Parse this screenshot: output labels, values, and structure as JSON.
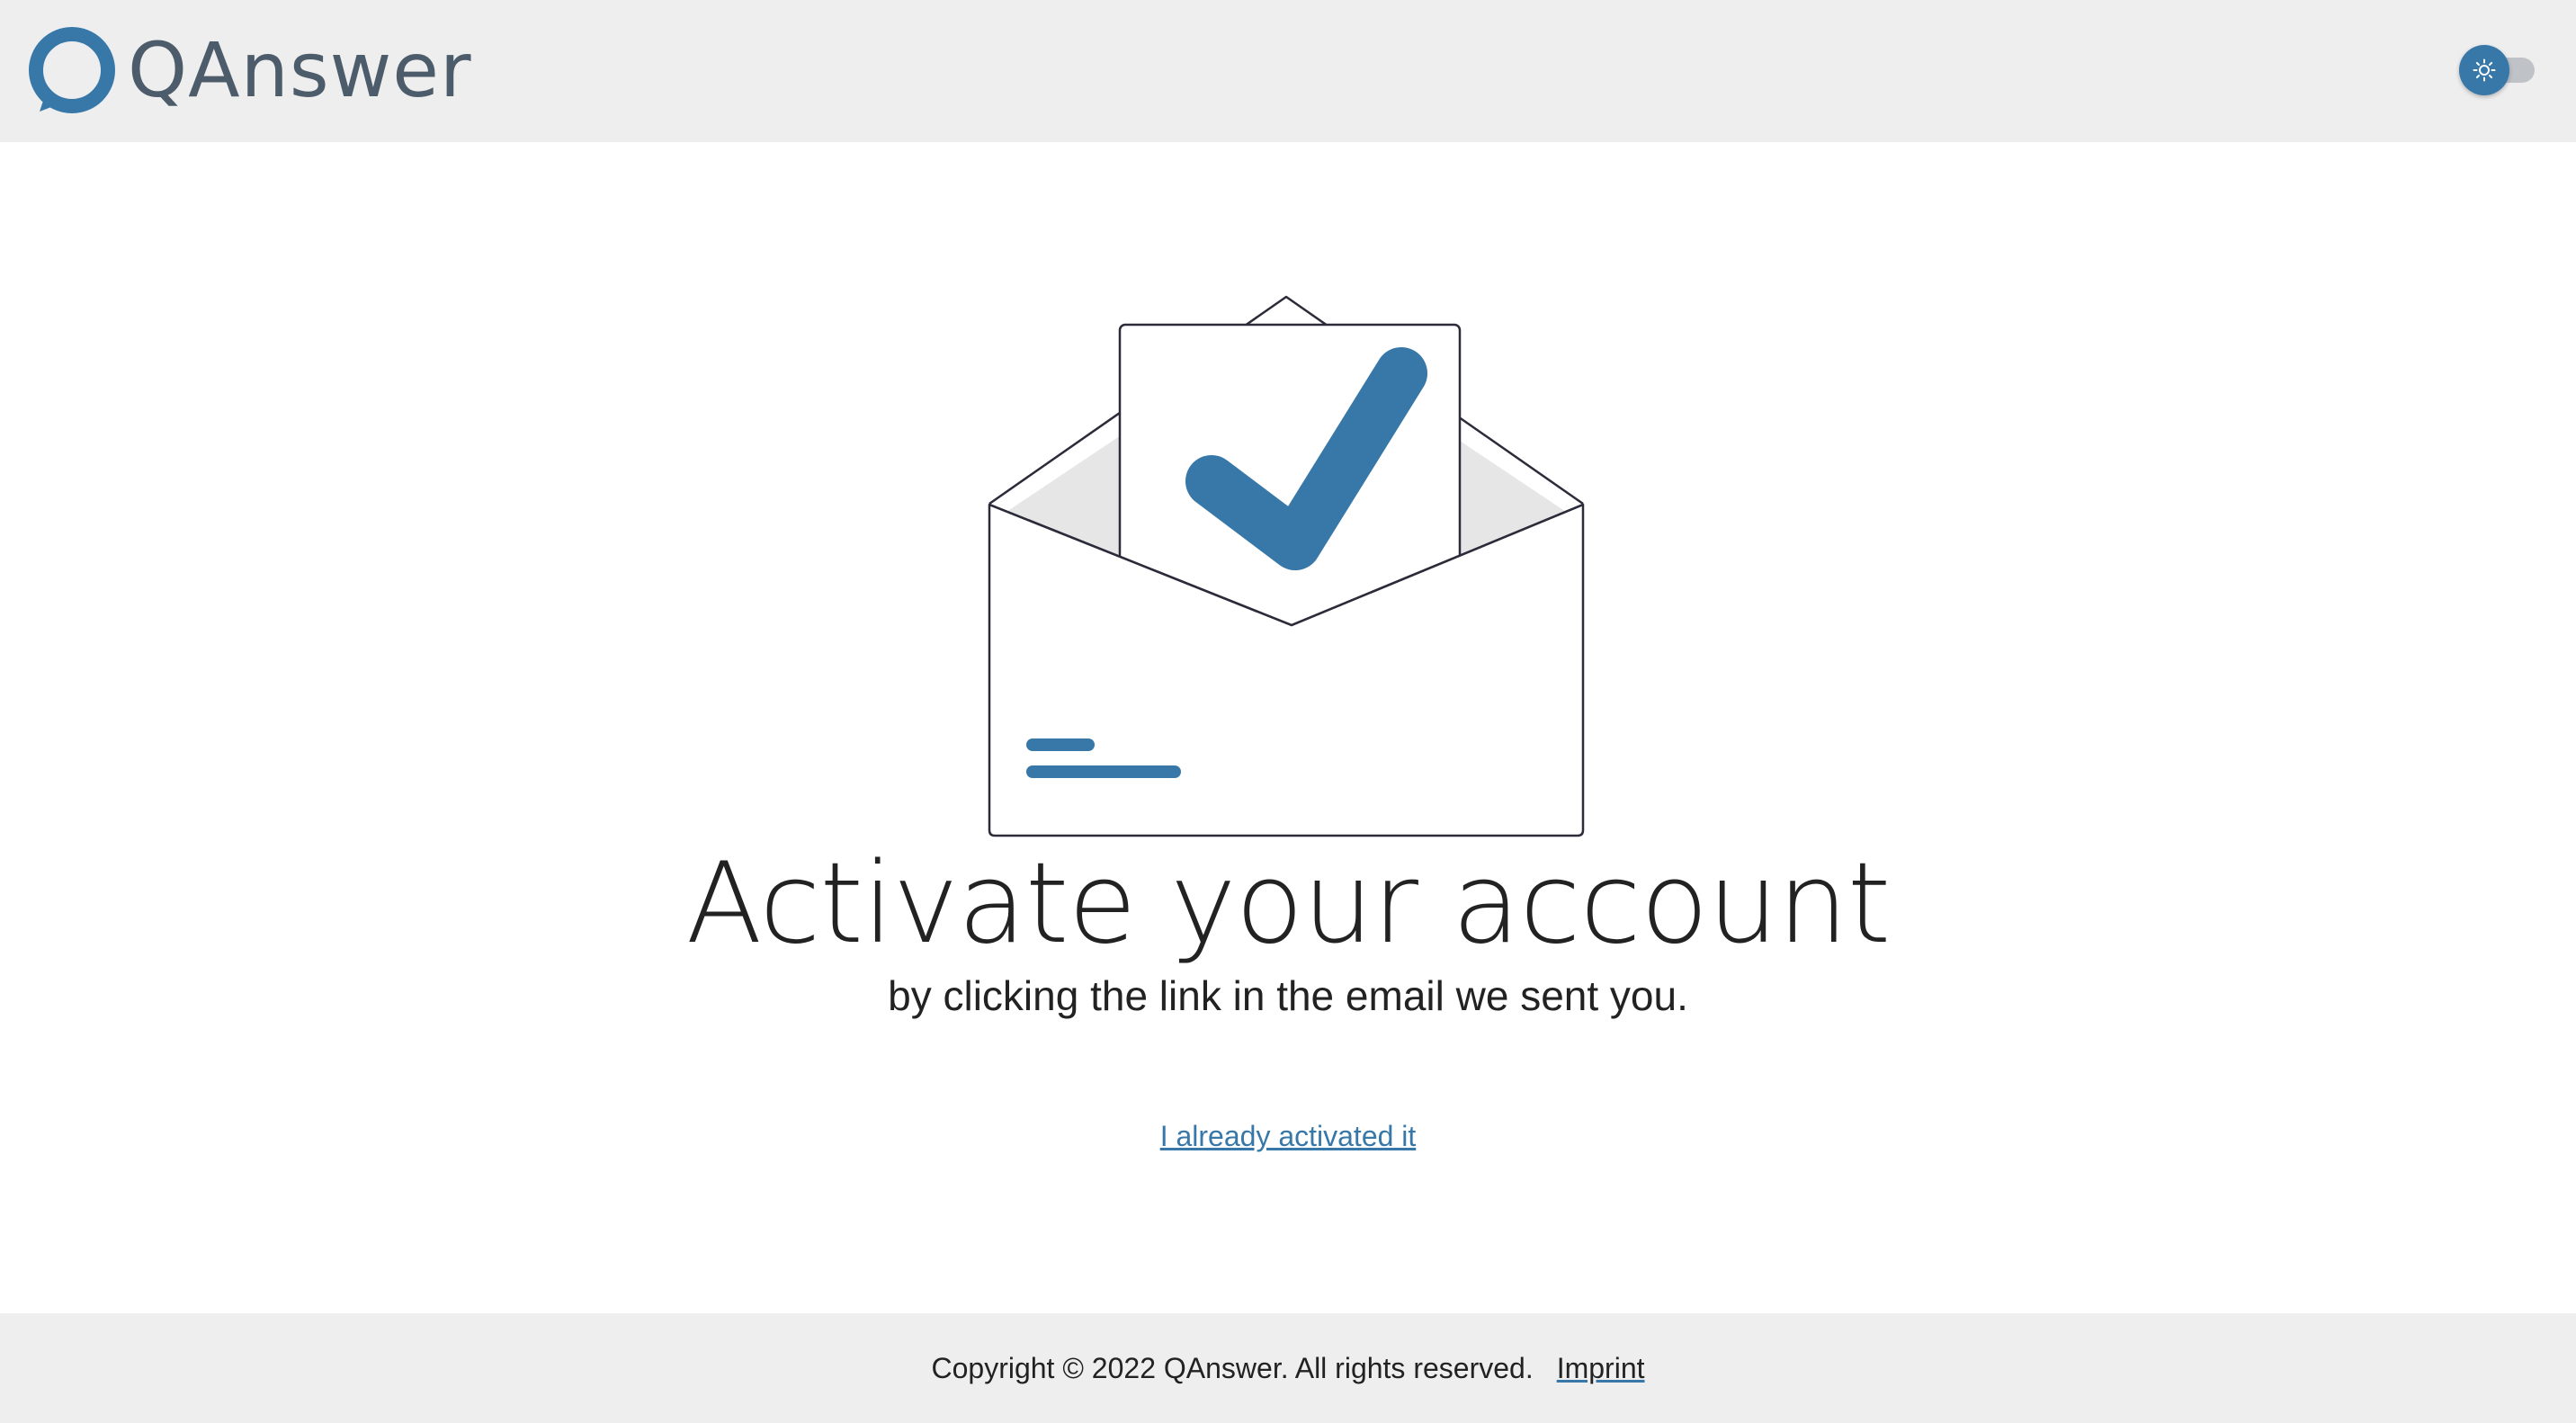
{
  "header": {
    "logo_text": "QAnswer",
    "theme_toggle_icon": "sun-icon"
  },
  "main": {
    "illustration_icon": "envelope-checkmark-icon",
    "title": "Activate your account",
    "subtitle": "by clicking the link in the email we sent you.",
    "activated_link": "I already activated it"
  },
  "footer": {
    "copyright": "Copyright © 2022 QAnswer. All rights reserved.",
    "imprint": "Imprint"
  },
  "colors": {
    "accent": "#3778a9",
    "header_bg": "#eeeeef",
    "text": "#222222",
    "logo_text": "#4d5c6b"
  }
}
